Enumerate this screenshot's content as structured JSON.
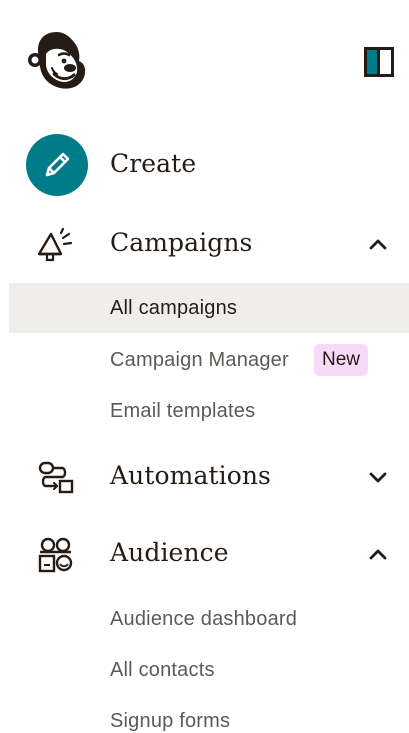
{
  "sidebar": {
    "create": {
      "label": "Create"
    },
    "campaigns": {
      "label": "Campaigns",
      "expanded": true,
      "items": [
        {
          "label": "All campaigns",
          "active": true
        },
        {
          "label": "Campaign Manager",
          "badge": "New"
        },
        {
          "label": "Email templates"
        }
      ]
    },
    "automations": {
      "label": "Automations",
      "expanded": false
    },
    "audience": {
      "label": "Audience",
      "expanded": true,
      "items": [
        {
          "label": "Audience dashboard"
        },
        {
          "label": "All contacts"
        },
        {
          "label": "Signup forms"
        }
      ]
    }
  },
  "colors": {
    "create_circle": "#007c89",
    "active_bg": "#efeeea",
    "badge_bg": "#f6dbf7",
    "text": "#241c15",
    "muted_text": "#5d5a56"
  },
  "icons": {
    "logo": "mailchimp-freddie-logo",
    "toggle": "sidebar-toggle-icon",
    "create": "pencil-icon",
    "campaigns": "megaphone-icon",
    "automations": "workflow-icon",
    "audience": "audience-icon",
    "expanded": "chevron-up-icon",
    "collapsed": "chevron-down-icon"
  }
}
